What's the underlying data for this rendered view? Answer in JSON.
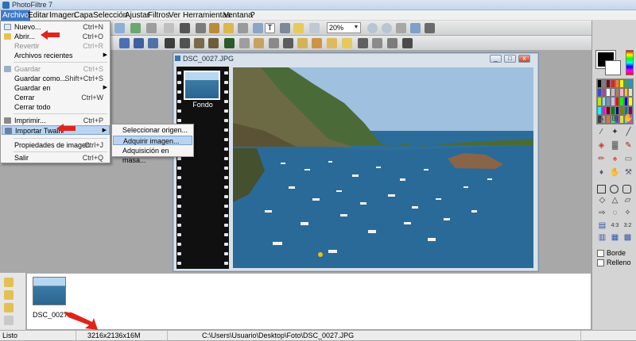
{
  "window": {
    "title": "PhotoFiltre 7"
  },
  "menu": [
    "Archivo",
    "Editar",
    "Imagen",
    "Capa",
    "Selección",
    "Ajustar",
    "Filtros",
    "Ver",
    "Herramientas",
    "Ventana",
    "?"
  ],
  "file_menu": {
    "items": [
      {
        "label": "Nuevo...",
        "shortcut": "Ctrl+N",
        "enabled": true,
        "icon": "new-icon"
      },
      {
        "label": "Abrir...",
        "shortcut": "Ctrl+O",
        "enabled": true,
        "icon": "open-folder-icon"
      },
      {
        "label": "Revertir",
        "shortcut": "Ctrl+R",
        "enabled": false
      },
      {
        "label": "Archivos recientes",
        "shortcut": "",
        "enabled": true,
        "submenu": true
      },
      {
        "label": "Guardar",
        "shortcut": "Ctrl+S",
        "enabled": false,
        "icon": "save-icon"
      },
      {
        "label": "Guardar como...",
        "shortcut": "Shift+Ctrl+S",
        "enabled": true
      },
      {
        "label": "Guardar en",
        "shortcut": "",
        "enabled": true,
        "submenu": true
      },
      {
        "label": "Cerrar",
        "shortcut": "Ctrl+W",
        "enabled": true
      },
      {
        "label": "Cerrar todo",
        "shortcut": "",
        "enabled": true
      },
      {
        "label": "Imprimir...",
        "shortcut": "Ctrl+P",
        "enabled": true,
        "icon": "print-icon"
      },
      {
        "label": "Importar Twain",
        "shortcut": "",
        "enabled": true,
        "submenu": true,
        "highlighted": true,
        "icon": "scanner-icon"
      },
      {
        "label": "Propiedades de imagen",
        "shortcut": "Ctrl+J",
        "enabled": true
      },
      {
        "label": "Salir",
        "shortcut": "Ctrl+Q",
        "enabled": true
      }
    ]
  },
  "twain_submenu": {
    "items": [
      {
        "label": "Seleccionar origen..."
      },
      {
        "label": "Adquirir imagen...",
        "highlighted": true
      },
      {
        "label": "Adquisición en masa..."
      }
    ]
  },
  "toolbar": {
    "zoom_value": "20%"
  },
  "document": {
    "title": "DSC_0027.JPG",
    "layer_label": "Fondo"
  },
  "right_panel": {
    "border_label": "Borde",
    "fill_label": "Relleno"
  },
  "thumbnail": {
    "label": "DSC_0027"
  },
  "status": {
    "ready": "Listo",
    "dimensions": "3216x2136x16M",
    "path": "C:\\Users\\Usuario\\Desktop\\Foto\\DSC_0027.JPG"
  },
  "colors": {
    "accent_menu": "#3d79c8",
    "highlight": "#b9d4f1",
    "arrow": "#e0241b"
  }
}
